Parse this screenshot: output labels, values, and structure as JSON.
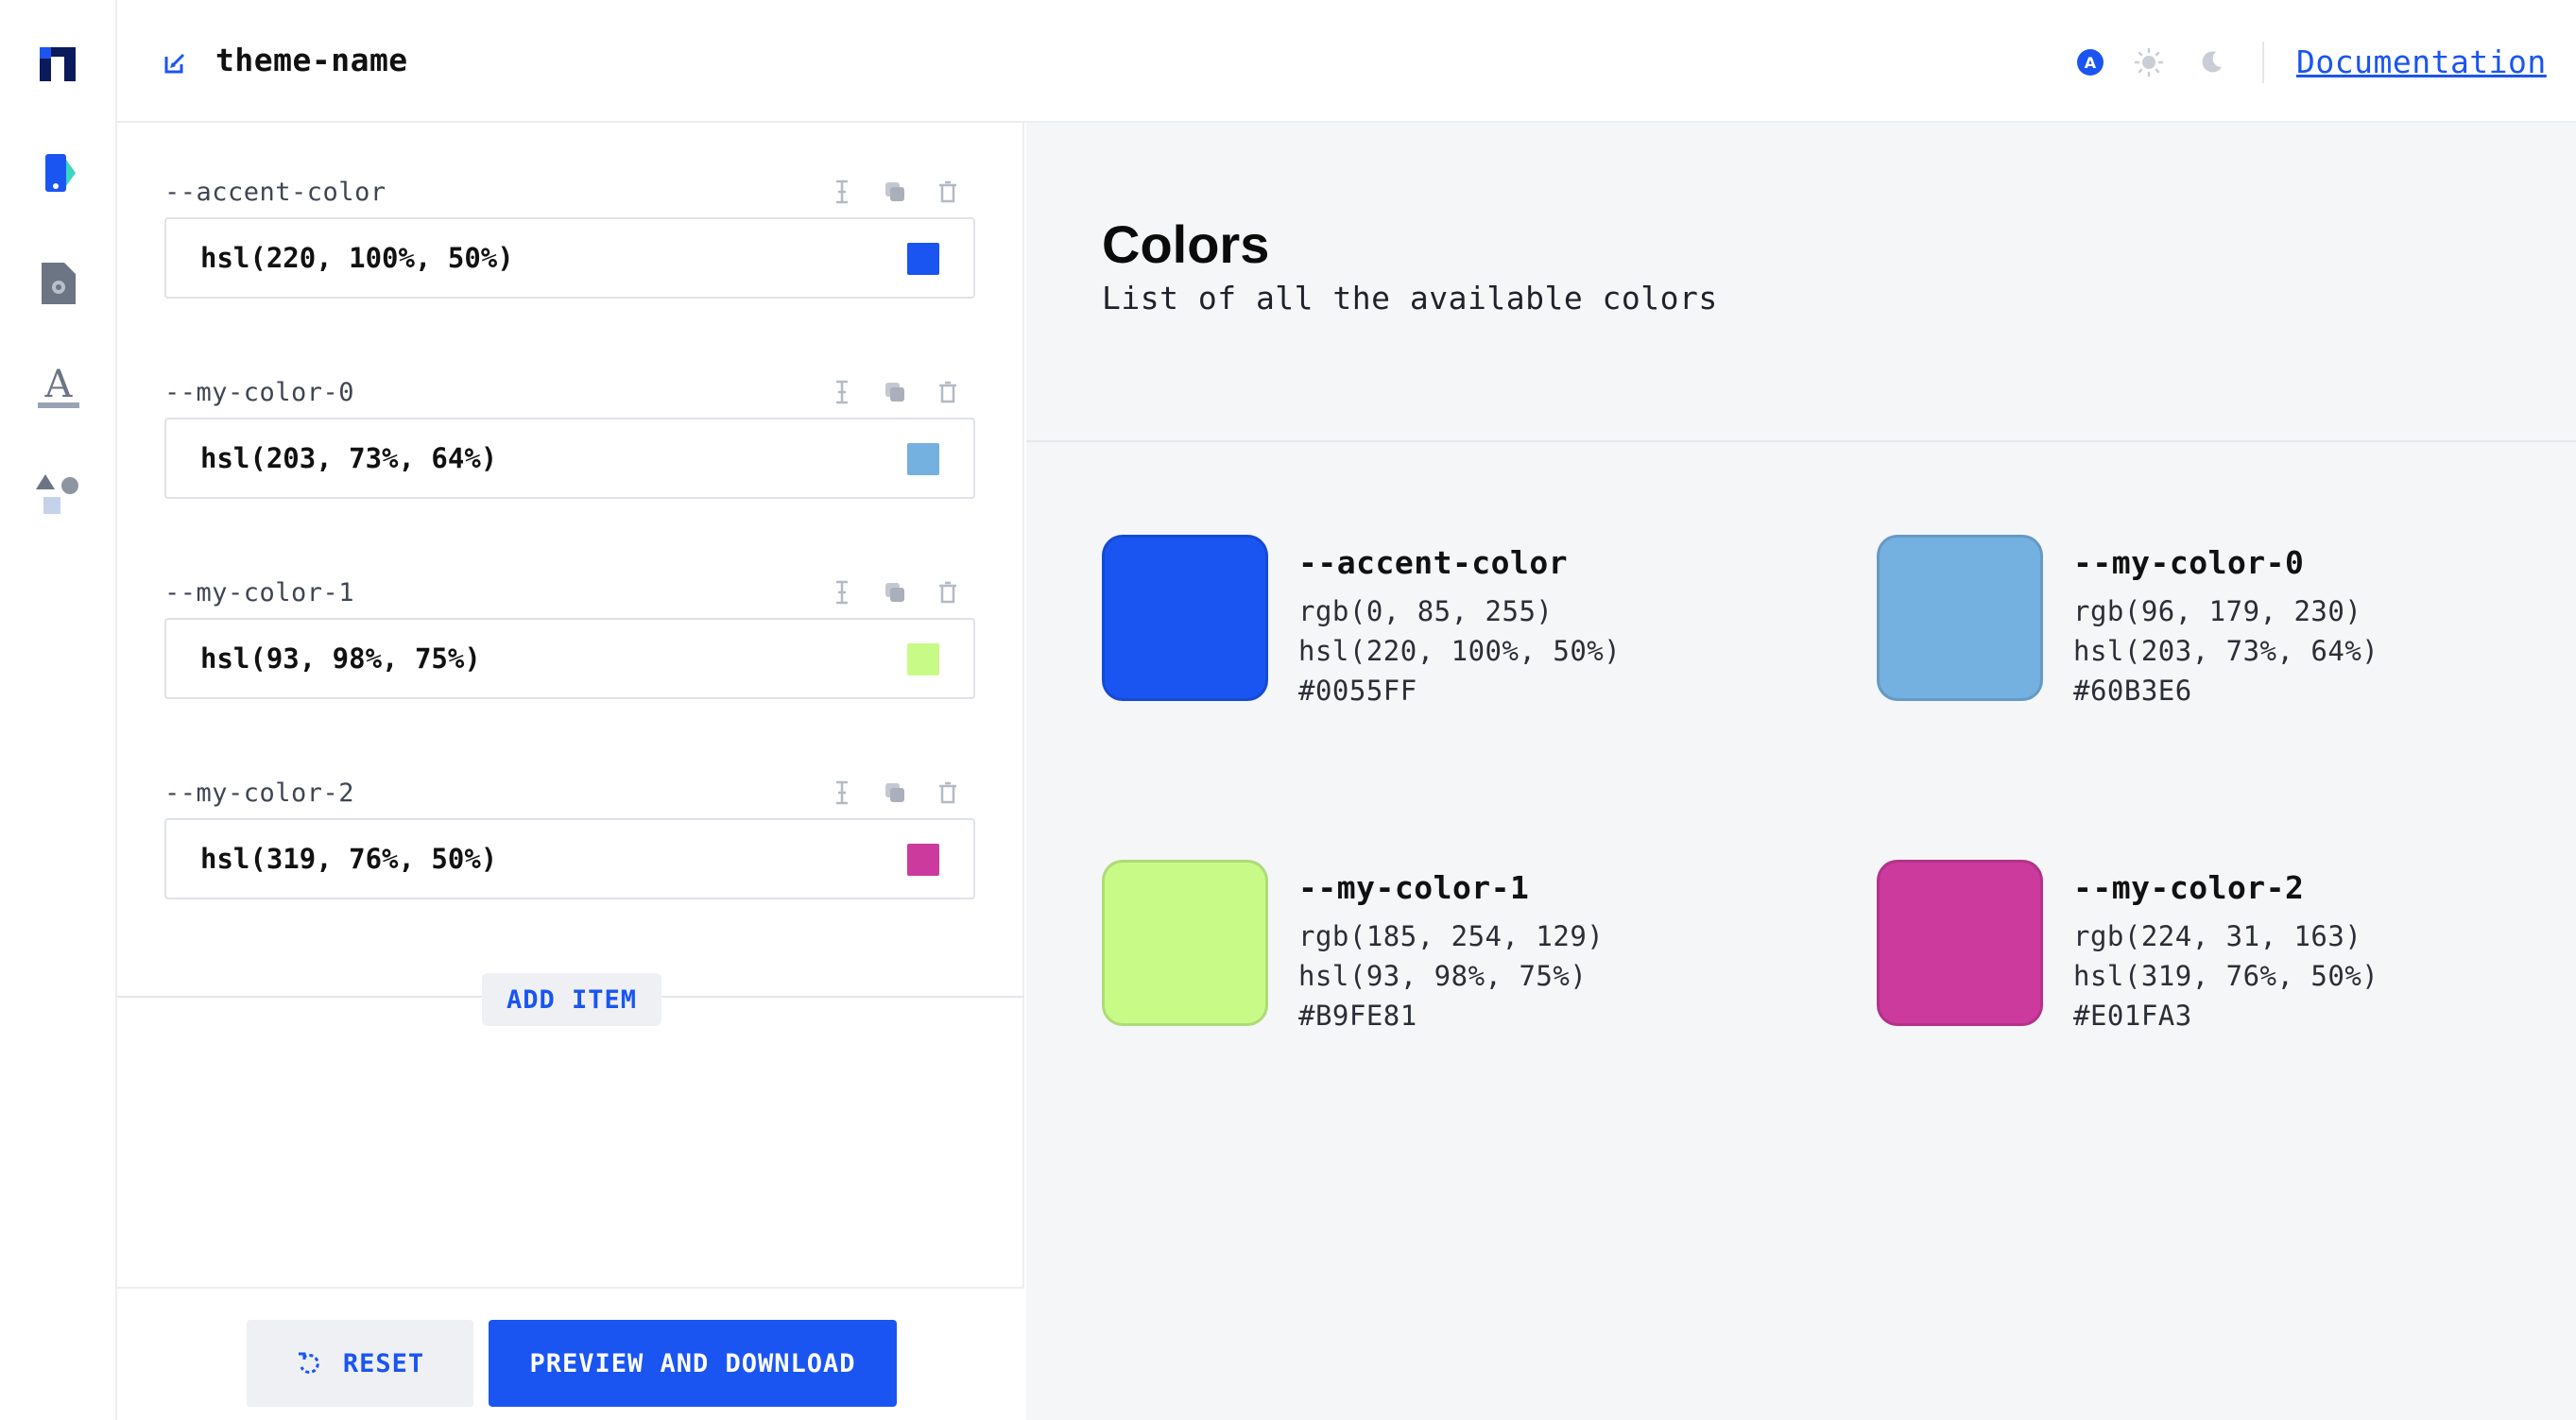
{
  "header": {
    "theme_name": "theme-name",
    "mode_auto_label": "A",
    "documentation_link": "Documentation"
  },
  "sidebar": {
    "items": [
      {
        "icon": "palette-icon"
      },
      {
        "icon": "settings-file-icon"
      },
      {
        "icon": "typography-icon"
      },
      {
        "icon": "shapes-icon"
      }
    ]
  },
  "editor": {
    "variables": [
      {
        "name": "--accent-color",
        "value": "hsl(220, 100%, 50%)",
        "swatch": "#1a55f2"
      },
      {
        "name": "--my-color-0",
        "value": "hsl(203, 73%, 64%)",
        "swatch": "#60B3E6"
      },
      {
        "name": "--my-color-1",
        "value": "hsl(93, 98%, 75%)",
        "swatch": "#B9FE81"
      },
      {
        "name": "--my-color-2",
        "value": "hsl(319, 76%, 50%)",
        "swatch": "#E01FA3"
      }
    ],
    "add_item_label": "ADD ITEM",
    "reset_label": "RESET",
    "preview_download_label": "PREVIEW AND DOWNLOAD"
  },
  "preview": {
    "title": "Colors",
    "subtitle": "List of all the available colors",
    "colors": [
      {
        "name": "--accent-color",
        "rgb": "rgb(0, 85, 255)",
        "hsl": "hsl(220, 100%, 50%)",
        "hex": "#0055FF",
        "chip": "#1a55f2"
      },
      {
        "name": "--my-color-0",
        "rgb": "rgb(96, 179, 230)",
        "hsl": "hsl(203, 73%, 64%)",
        "hex": "#60B3E6",
        "chip": "#74b0e0"
      },
      {
        "name": "--my-color-1",
        "rgb": "rgb(185, 254, 129)",
        "hsl": "hsl(93, 98%, 75%)",
        "hex": "#B9FE81",
        "chip": "#c8fa88"
      },
      {
        "name": "--my-color-2",
        "rgb": "rgb(224, 31, 163)",
        "hsl": "hsl(319, 76%, 50%)",
        "hex": "#E01FA3",
        "chip": "#cc3a9e"
      }
    ]
  },
  "colors": {
    "accent": "#1a55f2",
    "border": "#dfe2e7",
    "panel_bg": "#f5f6f8"
  }
}
